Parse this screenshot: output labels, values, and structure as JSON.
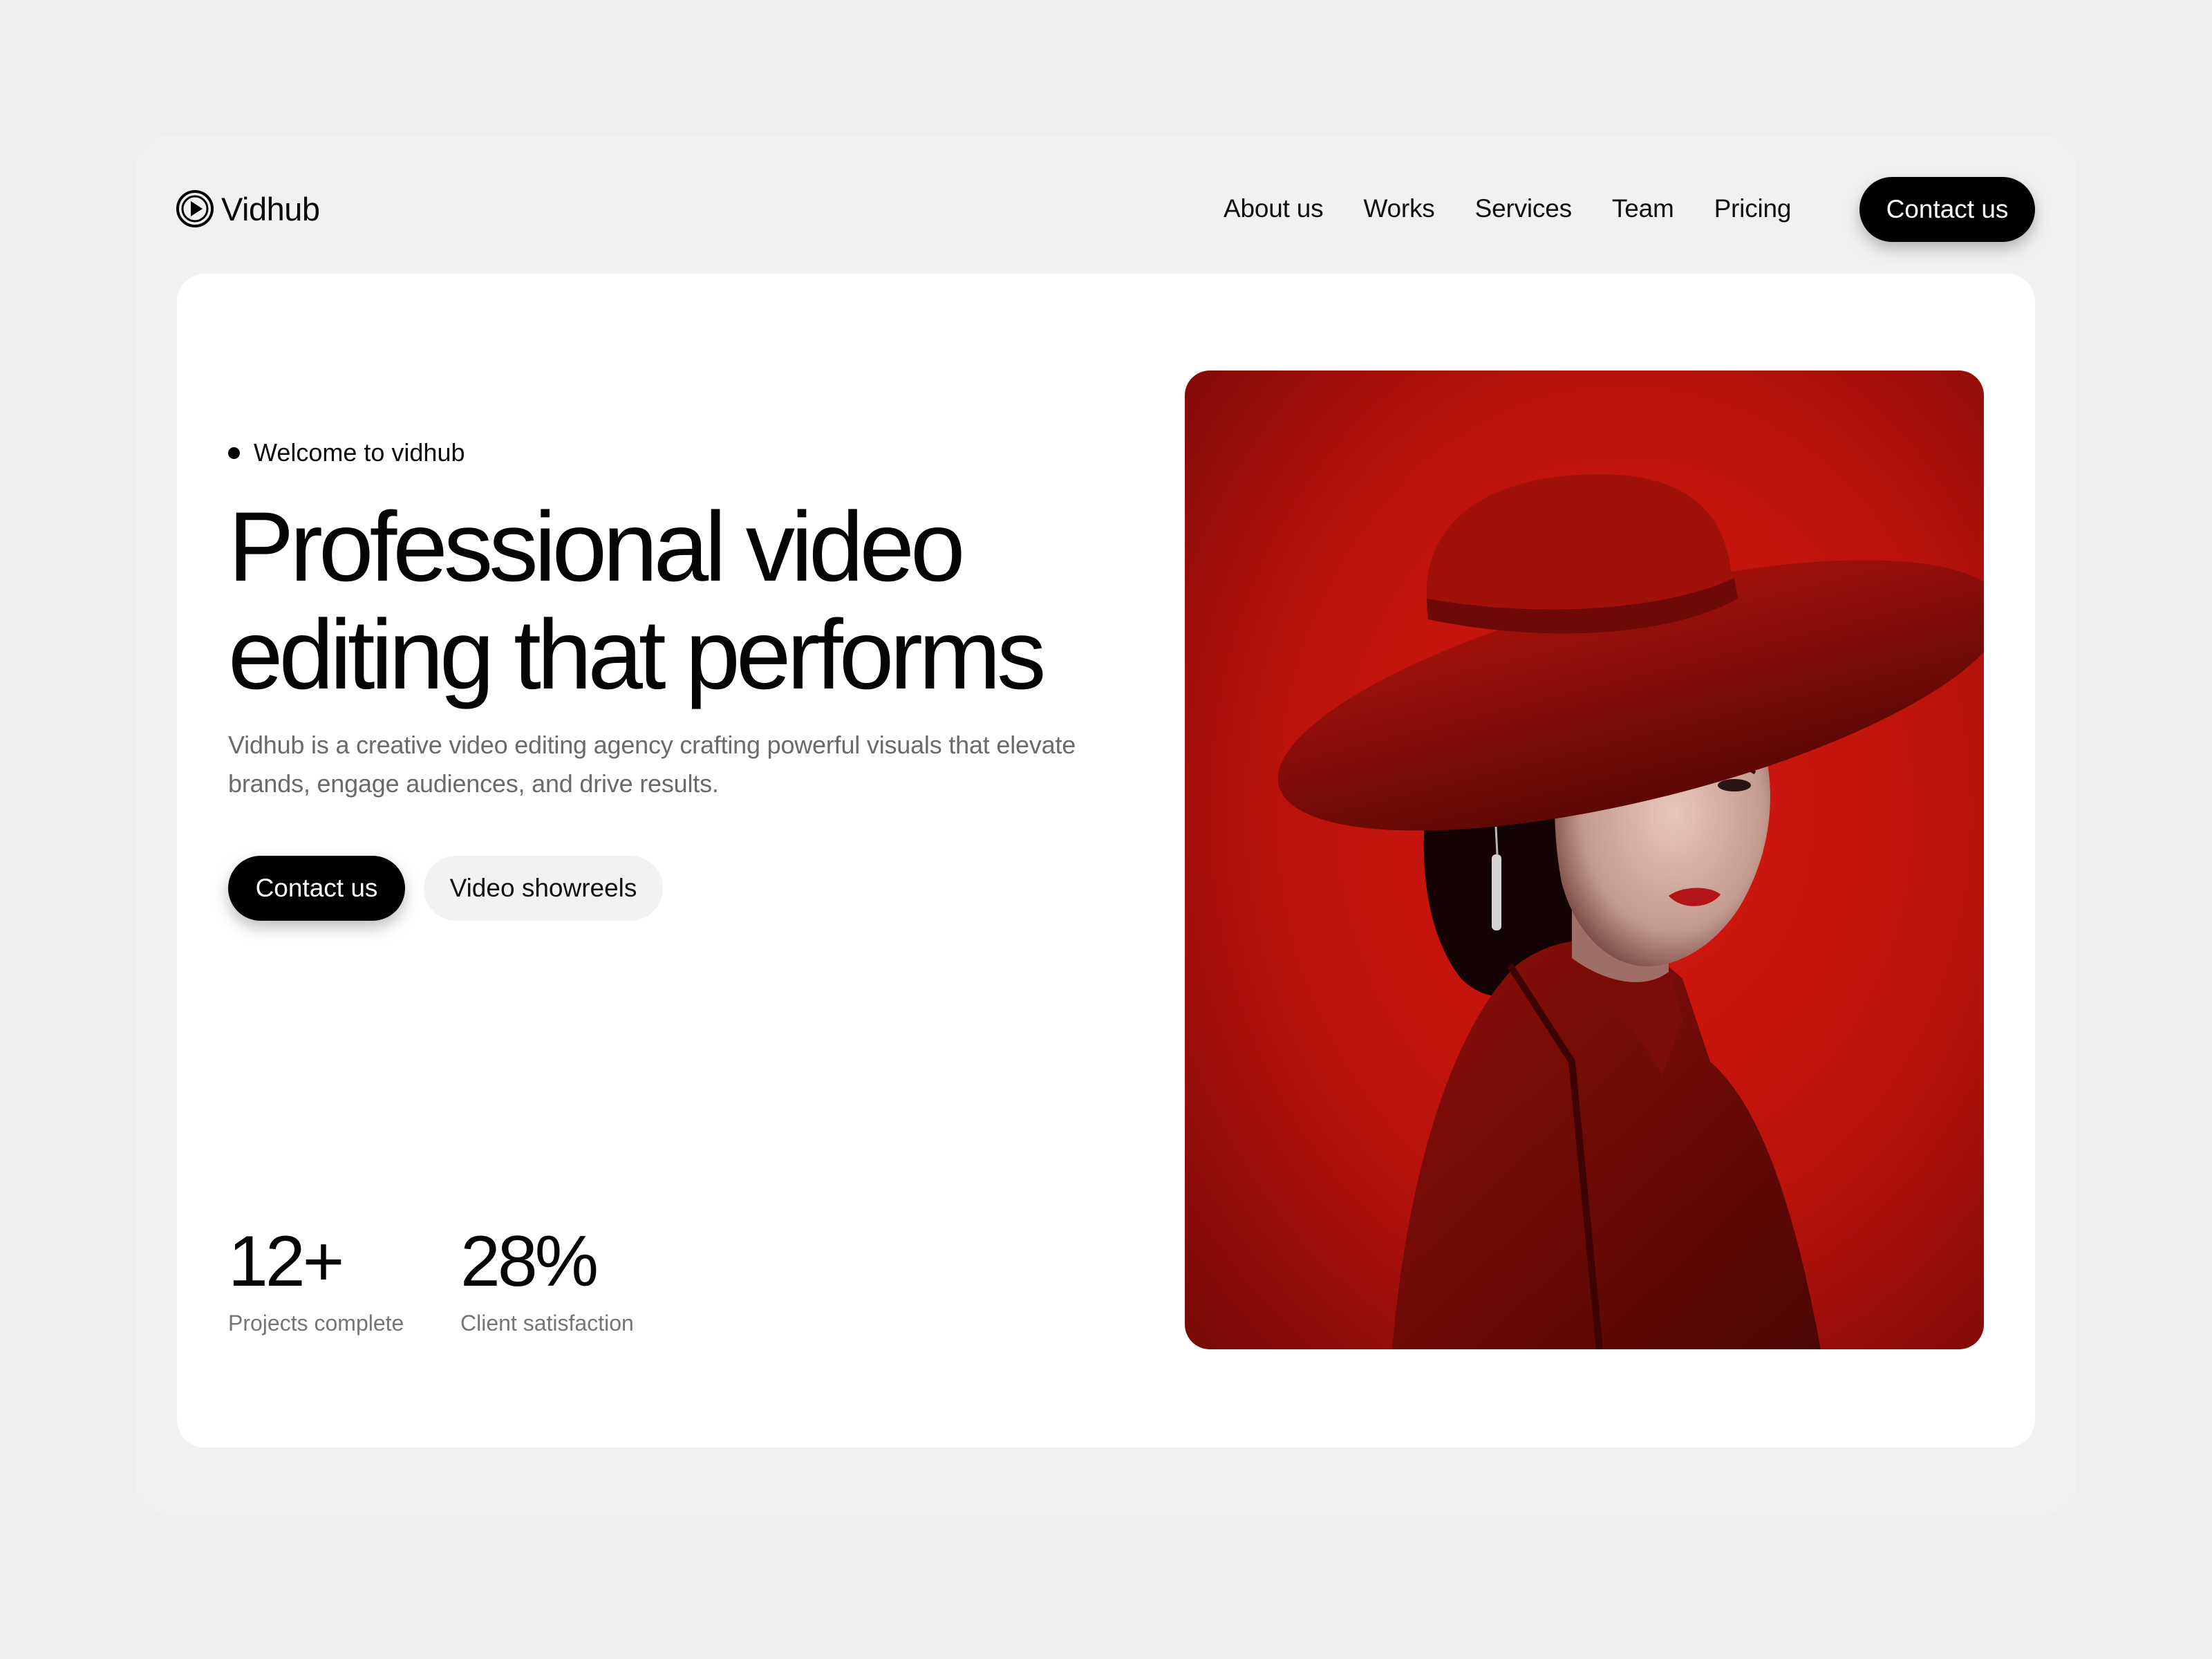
{
  "brand": {
    "name": "Vidhub"
  },
  "nav": {
    "items": [
      "About us",
      "Works",
      "Services",
      "Team",
      "Pricing"
    ],
    "cta": "Contact us"
  },
  "hero": {
    "eyebrow": "Welcome to vidhub",
    "headline_line1": "Professional video",
    "headline_line2": "editing that performs",
    "subtext": "Vidhub is a creative video editing agency crafting powerful visuals that elevate brands, engage audiences, and drive results.",
    "primary_cta": "Contact us",
    "secondary_cta": "Video showreels"
  },
  "stats": [
    {
      "value": "12+",
      "label": "Projects complete"
    },
    {
      "value": "28%",
      "label": "Client satisfaction"
    }
  ],
  "colors": {
    "page_bg": "#efefef",
    "card_bg": "#ffffff",
    "accent_dark": "#000000",
    "photo_red": "#b8120c"
  },
  "icons": {
    "logo": "play-lens-icon",
    "eyebrow": "dot-icon"
  }
}
